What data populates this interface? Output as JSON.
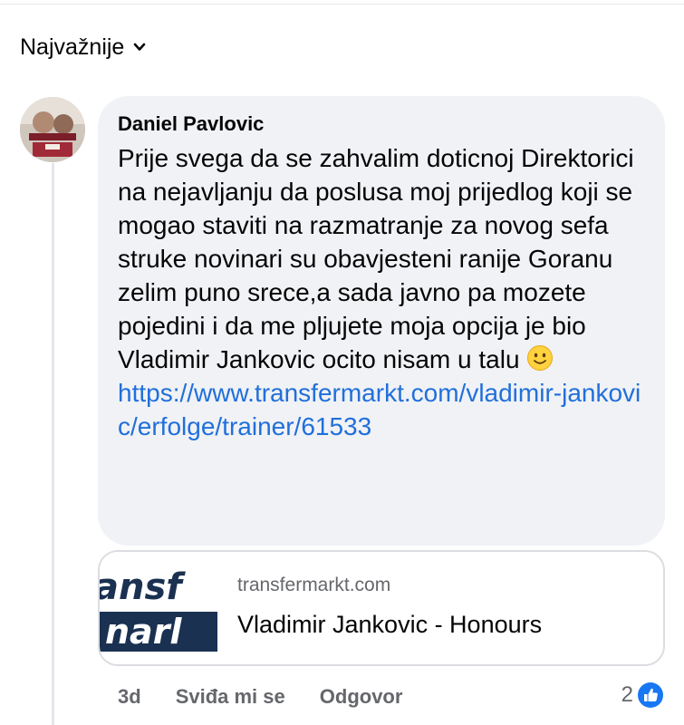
{
  "sort": {
    "label": "Najvažnije",
    "icon": "chevron-down-icon"
  },
  "comment": {
    "author": "Daniel Pavlovic",
    "text": "Prije svega da se zahvalim doticnoj Direktorici na nejavljanju da poslusa moj prijedlog koji se mogao staviti na razmatranje za novog sefa struke novinari su obavjesteni ranije Goranu zelim puno srece,a sada javno pa mozete pojedini i da me pljujete moja opcija je bio Vladimir Jankovic ocito nisam u talu",
    "emoji": "slightly-smiling-face-icon",
    "link": "https://www.transfermarkt.com/vladimir-jankovic/erfolge/trainer/61533",
    "time": "3d",
    "like_label": "Sviđa mi se",
    "reply_label": "Odgovor",
    "reaction_count": "2",
    "reaction_icon": "like-icon"
  },
  "preview": {
    "domain": "transfermarkt.com",
    "title": "Vladimir Jankovic - Honours",
    "thumb_logo_text": "transfermarkt",
    "thumb_colors": [
      "#1a3151",
      "#ffffff"
    ]
  },
  "colors": {
    "link": "#216fdb",
    "secondary_text": "#65676b",
    "bubble_bg": "#f0f2f5",
    "like_blue": "#1877f2"
  }
}
